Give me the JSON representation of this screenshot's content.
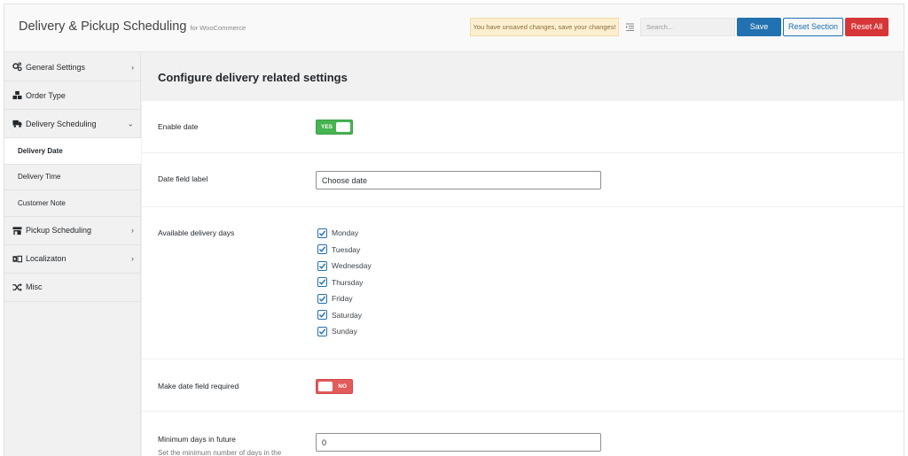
{
  "header": {
    "title": "Delivery & Pickup Scheduling",
    "subtitle": "for WooCommerce",
    "unsaved_notice": "You have unsaved changes, save your changes!",
    "search_placeholder": "Search...",
    "save_label": "Save",
    "reset_section_label": "Reset Section",
    "reset_all_label": "Reset All"
  },
  "sidebar": {
    "items": [
      {
        "label": "General Settings",
        "icon": "gears-icon"
      },
      {
        "label": "Order Type",
        "icon": "boxes-icon"
      },
      {
        "label": "Delivery Scheduling",
        "icon": "truck-icon"
      },
      {
        "label": "Pickup Scheduling",
        "icon": "store-icon"
      },
      {
        "label": "Localizaton",
        "icon": "language-icon"
      },
      {
        "label": "Misc",
        "icon": "random-icon"
      }
    ],
    "sub_items": [
      {
        "label": "Delivery Date",
        "active": true
      },
      {
        "label": "Delivery Time",
        "active": false
      },
      {
        "label": "Customer Note",
        "active": false
      }
    ]
  },
  "main": {
    "section_title": "Configure delivery related settings",
    "enable_date": {
      "label": "Enable date",
      "toggle_text": "YES",
      "value": true
    },
    "date_field_label": {
      "label": "Date field label",
      "value": "Choose date"
    },
    "available_days": {
      "label": "Available delivery days",
      "days": [
        {
          "label": "Monday",
          "checked": true
        },
        {
          "label": "Tuesday",
          "checked": true
        },
        {
          "label": "Wednesday",
          "checked": true
        },
        {
          "label": "Thursday",
          "checked": true
        },
        {
          "label": "Friday",
          "checked": true
        },
        {
          "label": "Saturday",
          "checked": true
        },
        {
          "label": "Sunday",
          "checked": true
        }
      ]
    },
    "date_required": {
      "label": "Make date field required",
      "toggle_text": "NO",
      "value": false
    },
    "min_days": {
      "label": "Minimum days in future",
      "description": "Set the minimum number of days in the",
      "value": "0"
    }
  },
  "colors": {
    "primary": "#2271b1",
    "danger": "#d63638",
    "toggle_on": "#46b450",
    "toggle_off": "#e35b5b",
    "notice_bg": "#fcefd0"
  }
}
